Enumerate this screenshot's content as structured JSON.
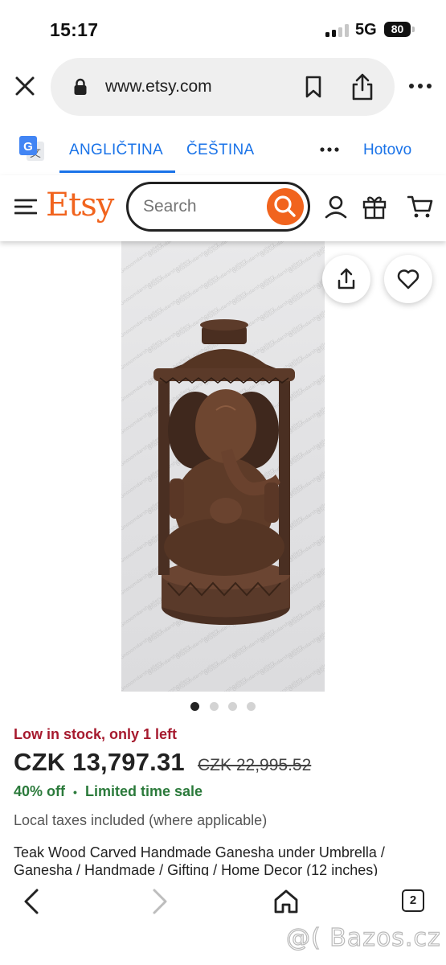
{
  "status_bar": {
    "time": "15:17",
    "network": "5G",
    "battery": "80"
  },
  "browser": {
    "url": "www.etsy.com",
    "icons": [
      "close-icon",
      "lock-icon",
      "bookmark-icon",
      "share-icon",
      "more-icon"
    ]
  },
  "translate": {
    "active_language": "ANGLIČTINA",
    "target_language": "ČEŠTINA",
    "done_label": "Hotovo",
    "accent": "#1a73e8"
  },
  "header": {
    "logo": "Etsy",
    "search_placeholder": "Search",
    "brand_color": "#f1641e",
    "icons": [
      "menu-icon",
      "search-icon",
      "account-icon",
      "gift-icon",
      "cart-icon"
    ]
  },
  "gallery": {
    "image_count": 4,
    "active_index": 0,
    "watermark_text": "Gnosomdarshgallery"
  },
  "product": {
    "stock_status": "Low in stock, only 1 left",
    "price": "CZK 13,797.31",
    "original_price": "CZK 22,995.52",
    "discount": "40% off",
    "sale_label": "Limited time sale",
    "discount_separator": "•",
    "tax_note": "Local taxes included (where applicable)",
    "title": "Teak Wood Carved Handmade Ganesha under Umbrella / Ganesha / Handmade / Gifting / Home Decor (12 inches)"
  },
  "bottom_nav": {
    "tab_count": "2",
    "icons": [
      "back-icon",
      "forward-icon",
      "home-icon",
      "tabs-icon"
    ]
  },
  "overlay_watermark": "@( Bazos.cz"
}
